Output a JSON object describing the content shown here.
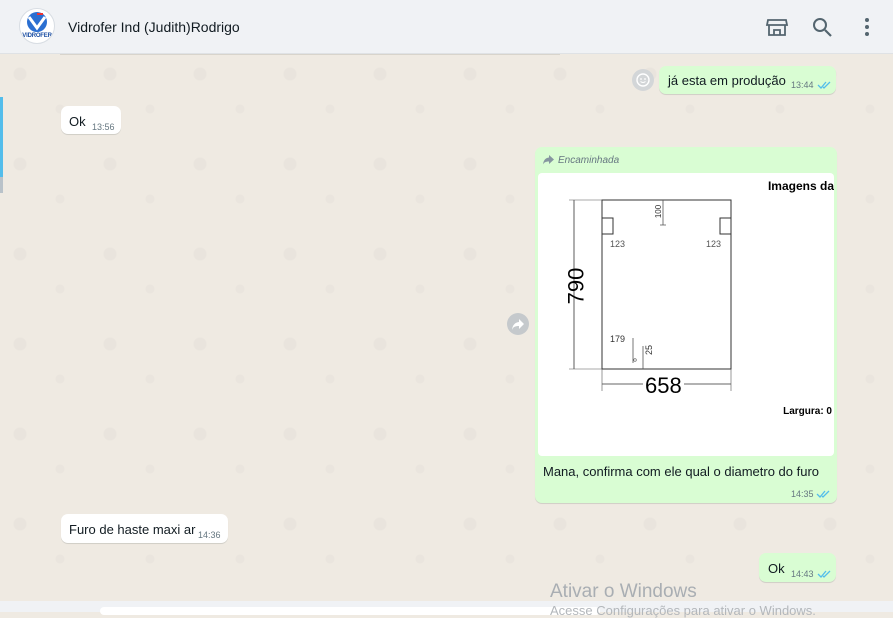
{
  "header": {
    "contact_name": "Vidrofer Ind (Judith)Rodrigo",
    "avatar_text": "VIDROFER",
    "icons": [
      "storefront-icon",
      "search-icon",
      "more-vert-icon"
    ]
  },
  "messages": [
    {
      "direction": "out",
      "text": "já esta em produção",
      "time": "13:44",
      "ticks": "read"
    },
    {
      "direction": "in",
      "text": "Ok",
      "time": "13:56"
    },
    {
      "direction": "out",
      "forwarded_label": "Encaminhada",
      "image": {
        "title": "Imagens da",
        "dim_height": "790",
        "dim_width": "658",
        "dim_top": "100",
        "dim_left_hole": "123",
        "dim_right_hole": "123",
        "dim_bottom_x": "179",
        "dim_bottom_y": "25",
        "largura": "Largura: 0"
      },
      "caption": "Mana, confirma com ele qual o diametro do furo",
      "time": "14:35",
      "ticks": "read"
    },
    {
      "direction": "in",
      "text": "Furo de haste maxi ar",
      "time": "14:36"
    },
    {
      "direction": "out",
      "text": "Ok",
      "time": "14:43",
      "ticks": "read"
    }
  ],
  "watermark": {
    "line1": "Ativar o Windows",
    "line2": "Acesse Configurações para ativar o Windows."
  },
  "colors": {
    "outgoing_bubble": "#d9fdd3",
    "incoming_bubble": "#ffffff",
    "chat_bg": "#efeae2",
    "read_tick": "#53bdeb"
  }
}
